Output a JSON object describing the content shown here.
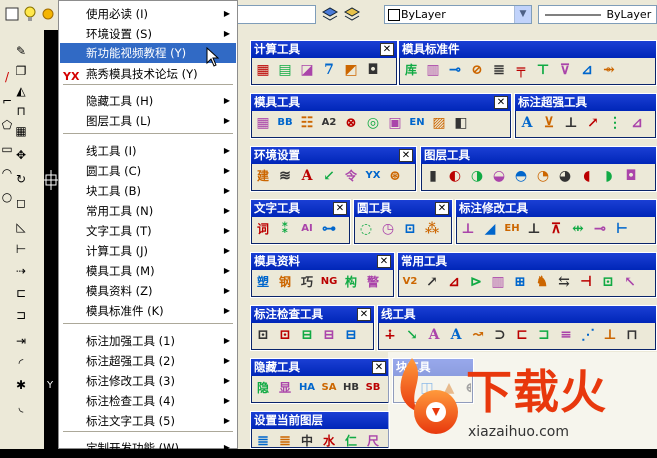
{
  "topbar": {
    "color_combo": "ByLayer",
    "linetype_combo": "ByLayer"
  },
  "menu": {
    "items": [
      {
        "label": "使用必读 (I)",
        "submenu": true
      },
      {
        "label": "环境设置 (S)",
        "submenu": true
      },
      {
        "label": "新功能视频教程 (Y)",
        "submenu": false,
        "highlighted": true
      },
      {
        "label": "燕秀模具技术论坛 (Y)",
        "submenu": false,
        "icon_text": "YX"
      },
      {
        "label": "隐藏工具 (H)",
        "submenu": true
      },
      {
        "label": "图层工具 (L)",
        "submenu": true
      },
      {
        "label": "线工具 (I)",
        "submenu": true
      },
      {
        "label": "圆工具 (C)",
        "submenu": true
      },
      {
        "label": "块工具 (B)",
        "submenu": true
      },
      {
        "label": "常用工具 (N)",
        "submenu": true
      },
      {
        "label": "文字工具 (T)",
        "submenu": true
      },
      {
        "label": "计算工具 (J)",
        "submenu": true
      },
      {
        "label": "模具工具 (M)",
        "submenu": true
      },
      {
        "label": "模具资料 (Z)",
        "submenu": true
      },
      {
        "label": "模具标准件 (K)",
        "submenu": true
      },
      {
        "label": "标注加强工具 (1)",
        "submenu": true
      },
      {
        "label": "标注超强工具 (2)",
        "submenu": true
      },
      {
        "label": "标注修改工具 (3)",
        "submenu": true
      },
      {
        "label": "标注检查工具 (4)",
        "submenu": true
      },
      {
        "label": "标注文字工具 (5)",
        "submenu": true
      },
      {
        "label": "定制开发功能 (W)",
        "submenu": true
      }
    ]
  },
  "toolbars": [
    {
      "title": "计算工具",
      "icons": [
        "▦",
        "▤",
        "◪",
        "7",
        "◩",
        "◘"
      ]
    },
    {
      "title": "模具标准件",
      "icons": [
        "库",
        "▥",
        "⊸",
        "⊘",
        "≣",
        "╤",
        "⊤",
        "⊽",
        "⊿",
        "⇴"
      ]
    },
    {
      "title": "模具工具",
      "icons": [
        "▦",
        "BB",
        "☷",
        "A2",
        "⊗",
        "◎",
        "▣",
        "EN",
        "▨",
        "◧"
      ]
    },
    {
      "title": "标注超强工具",
      "icons": [
        "A",
        "⊻",
        "⊥",
        "↗",
        "⋮",
        "⊿"
      ]
    },
    {
      "title": "环境设置",
      "icons": [
        "建",
        "≋",
        "A",
        "↙",
        "令",
        "YX",
        "⊛"
      ]
    },
    {
      "title": "图层工具",
      "icons": [
        "▮",
        "◐",
        "◑",
        "◒",
        "◓",
        "◔",
        "◕",
        "◖",
        "◗",
        "◘"
      ]
    },
    {
      "title": "文字工具",
      "icons": [
        "词",
        "⁑",
        "AI",
        "⊶"
      ]
    },
    {
      "title": "圆工具",
      "icons": [
        "◌",
        "◷",
        "⊡",
        "⁂"
      ]
    },
    {
      "title": "标注修改工具",
      "icons": [
        "⊥",
        "◢",
        "EH",
        "⊥",
        "⊼",
        "⇹",
        "⊸",
        "⊢"
      ]
    },
    {
      "title": "模具资料",
      "icons": [
        "塑",
        "钢",
        "巧",
        "NG",
        "构",
        "警"
      ]
    },
    {
      "title": "常用工具",
      "icons": [
        "V2",
        "↗",
        "⊿",
        "⊳",
        "▥",
        "⊞",
        "♞",
        "⇆",
        "⊣",
        "⊡",
        "↖"
      ]
    },
    {
      "title": "标注检查工具",
      "icons": [
        "⊡",
        "⊡",
        "⊟",
        "⊟",
        "⊟"
      ]
    },
    {
      "title": "线工具",
      "icons": [
        "∔",
        "↘",
        "A",
        "A",
        "↝",
        "⊃",
        "⊏",
        "⊐",
        "≡",
        "⋰",
        "⊥",
        "⊓"
      ]
    },
    {
      "title": "隐藏工具",
      "icons": [
        "隐",
        "显",
        "HA",
        "SA",
        "HB",
        "SB"
      ]
    },
    {
      "title": "块工具",
      "icons": [
        "↶",
        "◫",
        "▲",
        "⊕"
      ]
    },
    {
      "title": "设置当前图层",
      "icons": [
        "≣",
        "≣",
        "中",
        "水",
        "仁",
        "尺"
      ]
    }
  ],
  "watermark": {
    "text": "下载火",
    "url": "xiazaihuo.com"
  },
  "colors": {
    "title_blue": "#0a2ad0",
    "menu_highlight": "#316ac5",
    "face": "#ece9d8",
    "watermark_red": "#e8380d"
  }
}
